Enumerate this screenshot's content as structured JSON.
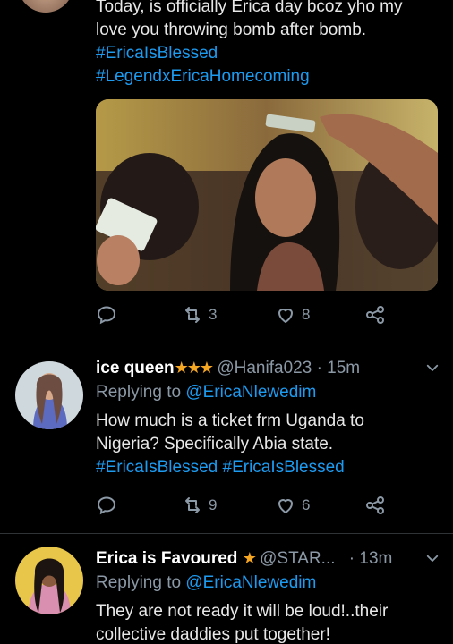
{
  "tweet1": {
    "lines": [
      "Today, is officially Erica day bcoz  yho my",
      "love you throwing bomb after bomb."
    ],
    "hashtags": [
      "#EricaIsBlessed",
      "#LegendxEricaHomecoming"
    ],
    "retweets": "3",
    "likes": "8"
  },
  "tweet2": {
    "name": "ice queen",
    "stars": "★★★",
    "handle": "@Hanifa023",
    "time": "· 15m",
    "replying_prefix": "Replying to",
    "replying_to": "@EricaNlewedim",
    "lines": [
      "How much is a ticket frm Uganda to",
      "Nigeria? Specifically Abia state."
    ],
    "hashtags_line": "#EricaIsBlessed #EricaIsBlessed",
    "retweets": "9",
    "likes": "6"
  },
  "tweet3": {
    "name": "Erica is Favoured",
    "stars": "★",
    "handle": "@STAR...",
    "time": "· 13m",
    "replying_prefix": "Replying to",
    "replying_to": "@EricaNlewedim",
    "lines": [
      "They are not ready it will be loud!..their",
      "collective daddies put together!"
    ]
  },
  "colors": {
    "background": "#000000",
    "link": "#1d9bf0",
    "muted": "#8b98a5",
    "star": "#f5a623"
  },
  "icons": [
    "reply-icon",
    "retweet-icon",
    "like-icon",
    "share-icon",
    "chevron-down-icon"
  ]
}
